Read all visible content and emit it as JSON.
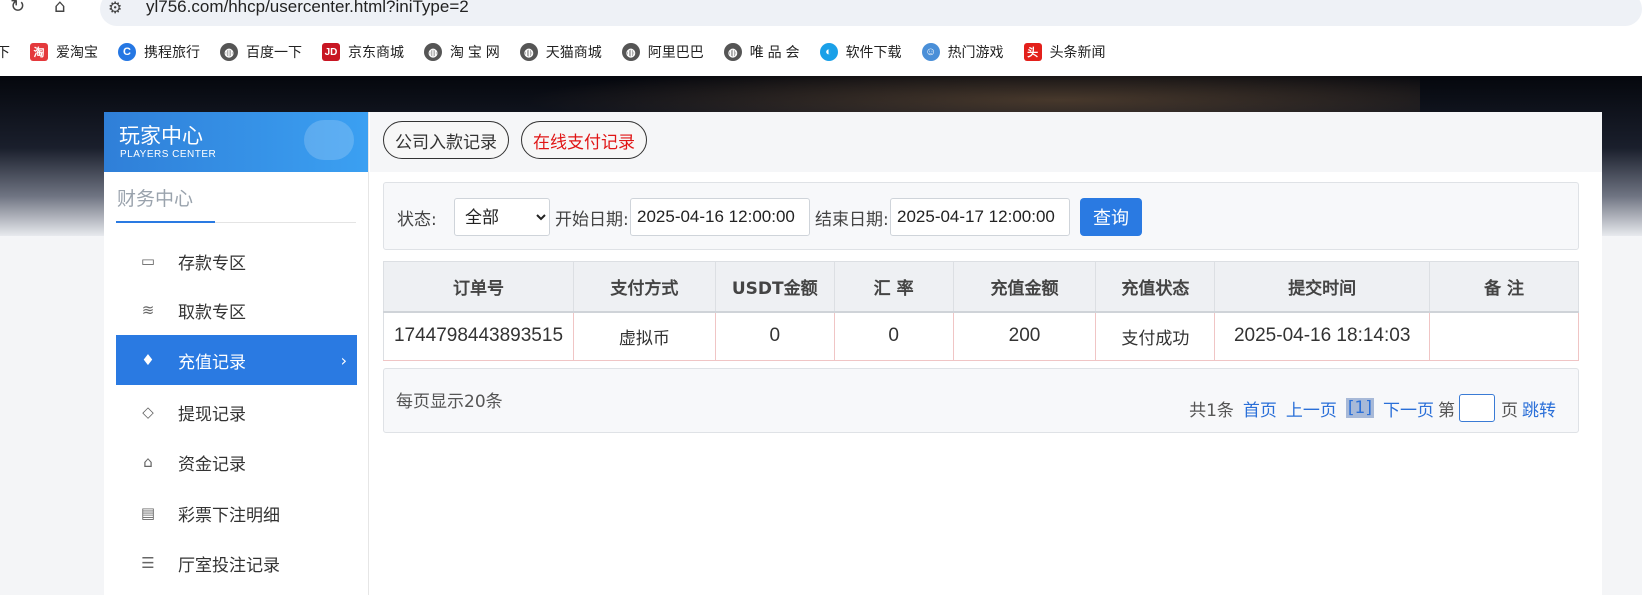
{
  "browser": {
    "url": "yl756.com/hhcp/usercenter.html?iniType=2",
    "bookmarks": [
      {
        "label": "爱淘宝",
        "icon": "taobao-icon",
        "color": "#e4393c",
        "glyph": "淘"
      },
      {
        "label": "携程旅行",
        "icon": "ctrip-icon",
        "color": "#2577e3",
        "glyph": "C"
      },
      {
        "label": "百度一下",
        "icon": "globe-icon",
        "color": "#555555",
        "glyph": "◍"
      },
      {
        "label": "京东商城",
        "icon": "jd-icon",
        "color": "#c81623",
        "glyph": "JD"
      },
      {
        "label": "淘 宝 网",
        "icon": "globe-icon",
        "color": "#555555",
        "glyph": "◍"
      },
      {
        "label": "天猫商城",
        "icon": "globe-icon",
        "color": "#555555",
        "glyph": "◍"
      },
      {
        "label": "阿里巴巴",
        "icon": "globe-icon",
        "color": "#555555",
        "glyph": "◍"
      },
      {
        "label": "唯 品 会",
        "icon": "globe-icon",
        "color": "#555555",
        "glyph": "◍"
      },
      {
        "label": "软件下载",
        "icon": "download-icon",
        "color": "#1aa0e8",
        "glyph": "◐"
      },
      {
        "label": "热门游戏",
        "icon": "game-icon",
        "color": "#4a8fd8",
        "glyph": "☺"
      },
      {
        "label": "头条新闻",
        "icon": "toutiao-icon",
        "color": "#e3201b",
        "glyph": "头"
      }
    ]
  },
  "sidebar": {
    "title": "玩家中心",
    "subtitle": "PLAYERS CENTER",
    "section": "财务中心",
    "items": [
      {
        "label": "存款专区",
        "icon": "card-icon"
      },
      {
        "label": "取款专区",
        "icon": "cash-icon"
      },
      {
        "label": "充值记录",
        "icon": "money-bag-icon",
        "active": true
      },
      {
        "label": "提现记录",
        "icon": "tag-icon"
      },
      {
        "label": "资金记录",
        "icon": "house-icon"
      },
      {
        "label": "彩票下注明细",
        "icon": "list-card-icon"
      },
      {
        "label": "厅室投注记录",
        "icon": "list-icon"
      }
    ]
  },
  "tabs": [
    {
      "label": "公司入款记录",
      "color": "#333333"
    },
    {
      "label": "在线支付记录",
      "color": "#e01515"
    }
  ],
  "filter": {
    "status_label": "状态:",
    "status_value": "全部",
    "start_label": "开始日期:",
    "start_value": "2025-04-16 12:00:00",
    "end_label": "结束日期:",
    "end_value": "2025-04-17 12:00:00",
    "query_button": "查询"
  },
  "table": {
    "headers": [
      "订单号",
      "支付方式",
      "USDT金额",
      "汇 率",
      "充值金额",
      "充值状态",
      "提交时间",
      "备 注"
    ],
    "rows": [
      [
        "1744798443893515",
        "虚拟币",
        "0",
        "0",
        "200",
        "支付成功",
        "2025-04-16 18:14:03",
        ""
      ]
    ]
  },
  "pager": {
    "per_page": "每页显示20条",
    "total": "共1条",
    "first": "首页",
    "prev": "上一页",
    "current": "[1]",
    "next": "下一页",
    "page_prefix": "第",
    "page_suffix": "页",
    "jump": "跳转"
  },
  "colors": {
    "accent": "#2a7ae2",
    "tab_active_text": "#e01515"
  }
}
